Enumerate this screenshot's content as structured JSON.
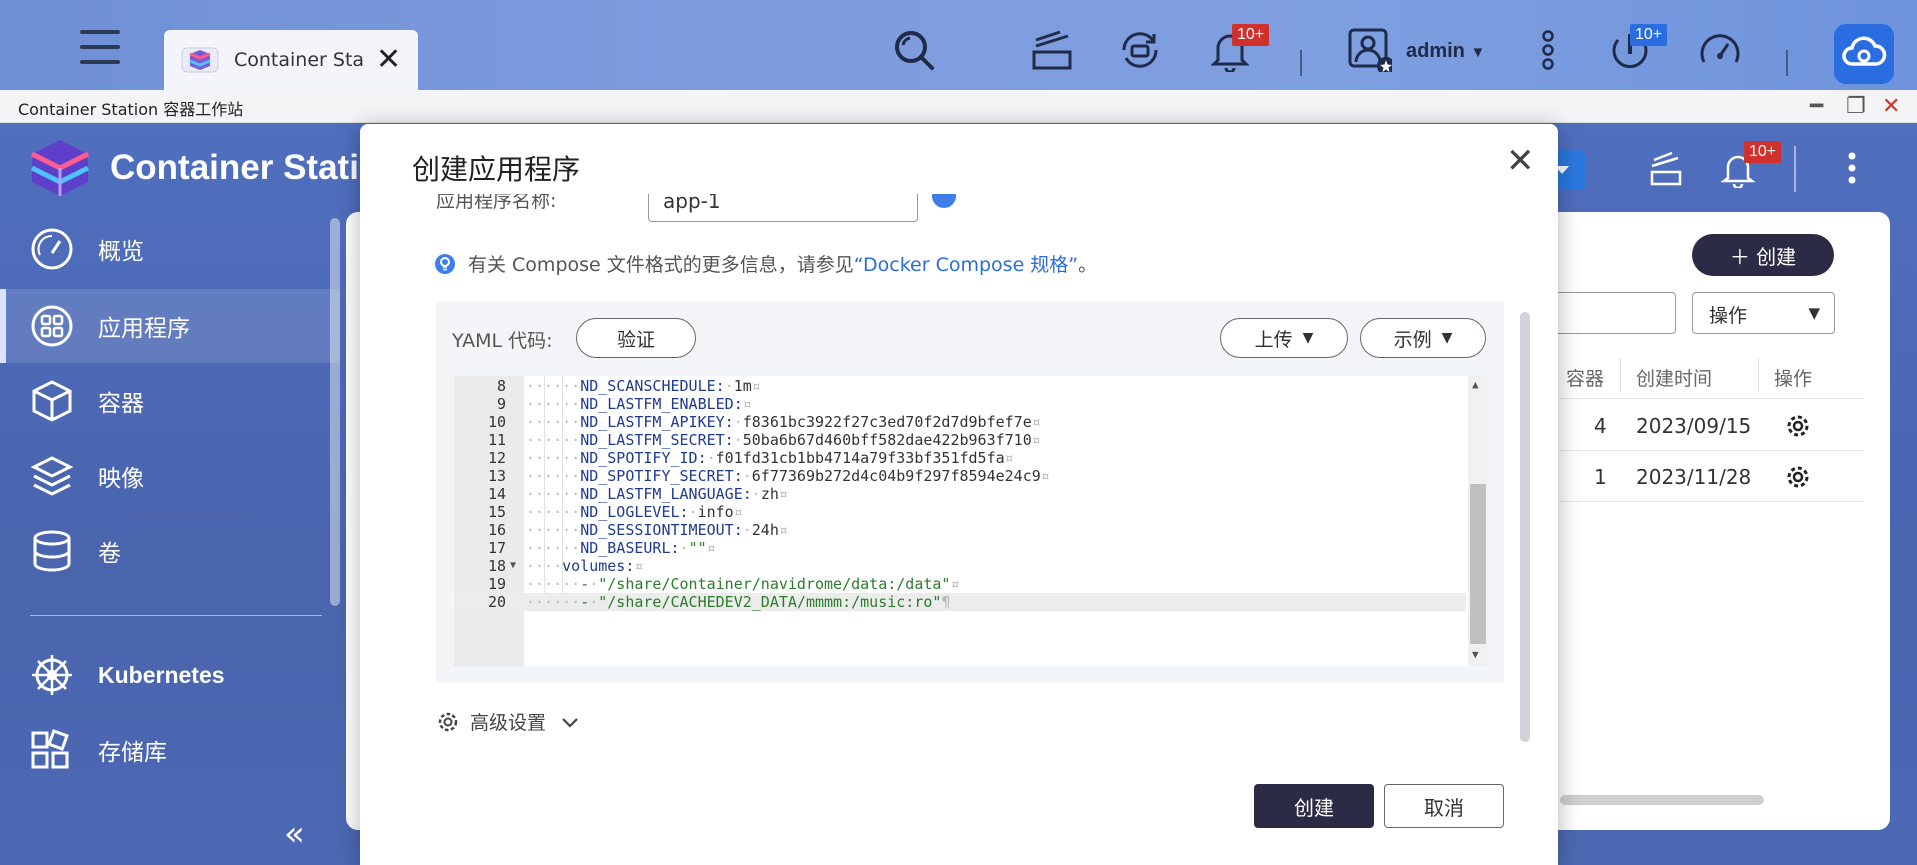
{
  "top": {
    "tab_title": "Container Sta...",
    "tab_close": "✕",
    "notif_badge": "10+",
    "user": "admin",
    "user_caret": "▼",
    "update_badge": "10+"
  },
  "window": {
    "title": "Container Station 容器工作站",
    "min": "━",
    "max": "❐",
    "close": "✕"
  },
  "app": {
    "name": "Container Station",
    "header_badge": "10+"
  },
  "sidebar": {
    "items": [
      {
        "label": "概览"
      },
      {
        "label": "应用程序"
      },
      {
        "label": "容器"
      },
      {
        "label": "映像"
      },
      {
        "label": "卷"
      },
      {
        "label": "Kubernetes"
      },
      {
        "label": "存储库"
      }
    ],
    "collapse": "«"
  },
  "main": {
    "create_label": "＋ 创建",
    "action_label": "操作",
    "action_caret": "▼",
    "columns": {
      "containers": "容器",
      "created": "创建时间",
      "actions": "操作"
    },
    "rows": [
      {
        "containers": "4",
        "created": "2023/09/15 1"
      },
      {
        "containers": "1",
        "created": "2023/11/28 1"
      }
    ]
  },
  "modal": {
    "title": "创建应用程序",
    "close": "✕",
    "name_label": "应用程序名称:",
    "name_value": "app-1",
    "hint_prefix": "有关 Compose 文件格式的更多信息，请参见",
    "hint_link": "“Docker Compose 规格”",
    "hint_suffix": "。",
    "yaml_label": "YAML 代码:",
    "validate": "验证",
    "upload": "上传",
    "example": "示例",
    "caret": "▼",
    "advanced": "高级设置",
    "create": "创建",
    "cancel": "取消"
  },
  "editor": {
    "lines": [
      {
        "n": "8",
        "indent": 6,
        "key": "ND_SCANSCHEDULE:",
        "val": "1m",
        "type": "val",
        "end": "¤"
      },
      {
        "n": "9",
        "indent": 6,
        "key": "ND_LASTFM_ENABLED:",
        "val": "",
        "type": "val",
        "end": "¤"
      },
      {
        "n": "10",
        "indent": 6,
        "key": "ND_LASTFM_APIKEY:",
        "val": "f8361bc3922f27c3ed70f2d7d9bfef7e",
        "type": "val",
        "end": "¤"
      },
      {
        "n": "11",
        "indent": 6,
        "key": "ND_LASTFM_SECRET:",
        "val": "50ba6b67d460bff582dae422b963f710",
        "type": "val",
        "end": "¤"
      },
      {
        "n": "12",
        "indent": 6,
        "key": "ND_SPOTIFY_ID:",
        "val": "f01fd31cb1bb4714a79f33bf351fd5fa",
        "type": "val",
        "end": "¤"
      },
      {
        "n": "13",
        "indent": 6,
        "key": "ND_SPOTIFY_SECRET:",
        "val": "6f77369b272d4c04b9f297f8594e24c9",
        "type": "val",
        "end": "¤"
      },
      {
        "n": "14",
        "indent": 6,
        "key": "ND_LASTFM_LANGUAGE:",
        "val": "zh",
        "type": "val",
        "end": "¤"
      },
      {
        "n": "15",
        "indent": 6,
        "key": "ND_LOGLEVEL:",
        "val": "info",
        "type": "val",
        "end": "¤"
      },
      {
        "n": "16",
        "indent": 6,
        "key": "ND_SESSIONTIMEOUT:",
        "val": "24h",
        "type": "val",
        "end": "¤"
      },
      {
        "n": "17",
        "indent": 6,
        "key": "ND_BASEURL:",
        "val": "\"\"",
        "type": "str",
        "end": "¤"
      },
      {
        "n": "18",
        "indent": 4,
        "key": "volumes:",
        "val": "",
        "type": "val",
        "end": "¤",
        "fold": "▼"
      },
      {
        "n": "19",
        "indent": 6,
        "key": "-",
        "val": "\"/share/Container/navidrome/data:/data\"",
        "type": "str",
        "end": "¤"
      },
      {
        "n": "20",
        "indent": 6,
        "key": "-",
        "val": "\"/share/CACHEDEV2_DATA/mmmm:/music:ro\"",
        "type": "str",
        "end": "¶",
        "current": true
      }
    ]
  }
}
